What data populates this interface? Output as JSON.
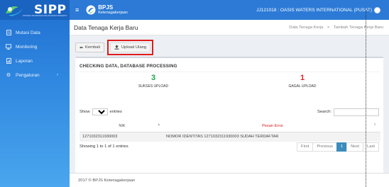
{
  "app": {
    "logo_text": "SIPP",
    "logo_sub": "SISTEM INFORMASI PELAPORAN PESERTA"
  },
  "sidebar": {
    "items": [
      {
        "label": "Mutasi Data",
        "icon": "file-icon"
      },
      {
        "label": "Monitoring",
        "icon": "monitor-icon"
      },
      {
        "label": "Laporan",
        "icon": "report-icon"
      },
      {
        "label": "Pengaturan",
        "icon": "gear-icon",
        "has_children": true
      }
    ]
  },
  "topbar": {
    "brand_title": "BPJS",
    "brand_sub": "Ketenagakerjaan",
    "user": "JJ121018 : OASIS WATERS INTERNATIONAL (PUSAT)"
  },
  "header": {
    "title": "Data Tenaga Kerja Baru",
    "breadcrumb": [
      "Data Tenaga Kerja",
      "Tambah Tenaga Kerja Baru"
    ],
    "separator": ">"
  },
  "toolbar": {
    "back_label": "Kembali",
    "upload_label": "Upload Ulang"
  },
  "box": {
    "title": "CHECKING DATA, DATABASE PROCESSING",
    "success_count": "3",
    "success_label": "SUKSES UPLOAD",
    "fail_count": "1",
    "fail_label": "GAGAL UPLOAD"
  },
  "datatable": {
    "show_label": "Show",
    "entries_label": "entries",
    "length_value": "10",
    "search_label": "Search:",
    "search_value": "",
    "columns": [
      "NIK",
      "Pesan Error"
    ],
    "rows": [
      [
        "1271032311930003",
        "NOMOR IDENTITAS 1271032311930003 SUDAH TERDAFTAR"
      ]
    ],
    "info": "Showing 1 to 1 of 1 entries",
    "pager": [
      "First",
      "Previous",
      "1",
      "Next",
      "Last"
    ]
  },
  "footer": {
    "text": "2017 © BPJS Ketenagakerjaan"
  },
  "colors": {
    "sidebar": "#2f86df",
    "topbar": "#2c7ad6",
    "success": "#1aa34a",
    "fail": "#e02424",
    "highlight": "#e01b1b"
  }
}
